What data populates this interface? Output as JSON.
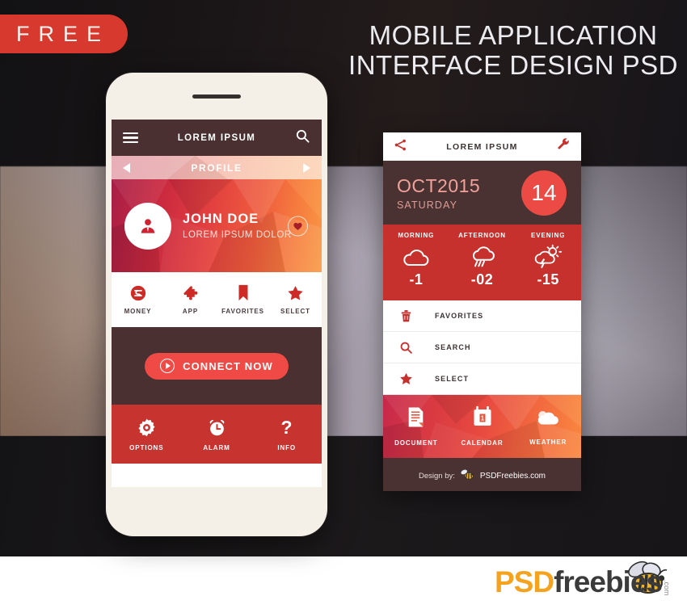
{
  "poster": {
    "badge": "FREE",
    "headline_line1": "MOBILE APPLICATION",
    "headline_line2": "INTERFACE DESIGN PSD"
  },
  "phone": {
    "app_bar": {
      "menu_icon": "hamburger-icon",
      "title": "LOREM IPSUM",
      "search_icon": "search-icon"
    },
    "profile_nav": {
      "prev_icon": "arrow-left-icon",
      "label": "PROFILE",
      "next_icon": "arrow-right-icon"
    },
    "hero": {
      "avatar_icon": "user-icon",
      "name": "JOHN DOE",
      "subtitle": "LOREM IPSUM DOLOR",
      "favorite_icon": "heart-icon"
    },
    "quick_actions": [
      {
        "label": "MONEY",
        "icon": "dollar-circle-icon"
      },
      {
        "label": "APP",
        "icon": "puzzle-icon"
      },
      {
        "label": "FAVORITES",
        "icon": "bookmark-icon"
      },
      {
        "label": "SELECT",
        "icon": "star-icon"
      }
    ],
    "connect": {
      "label": "CONNECT NOW",
      "icon": "play-circle-icon"
    },
    "bottom_actions": [
      {
        "label": "OPTIONS",
        "icon": "gear-icon"
      },
      {
        "label": "ALARM",
        "icon": "alarm-clock-icon"
      },
      {
        "label": "INFO",
        "icon": "question-mark-icon"
      }
    ]
  },
  "widget": {
    "head": {
      "share_icon": "share-icon",
      "title": "LOREM IPSUM",
      "settings_icon": "wrench-icon"
    },
    "date": {
      "month_year": "OCT2015",
      "weekday": "SATURDAY",
      "day": "14"
    },
    "weather": [
      {
        "label": "MORNING",
        "icon": "cloud-icon",
        "temp": "-1"
      },
      {
        "label": "AFTERNOON",
        "icon": "rain-cloud-icon",
        "temp": "-02"
      },
      {
        "label": "EVENING",
        "icon": "storm-sun-icon",
        "temp": "-15"
      }
    ],
    "list": [
      {
        "label": "FAVORITES",
        "icon": "trash-icon"
      },
      {
        "label": "SEARCH",
        "icon": "search-icon"
      },
      {
        "label": "SELECT",
        "icon": "star-icon"
      }
    ],
    "tabs": [
      {
        "label": "DOCUMENT",
        "icon": "document-icon"
      },
      {
        "label": "CALENDAR",
        "icon": "calendar-icon"
      },
      {
        "label": "WEATHER",
        "icon": "cloud-icon"
      }
    ],
    "footer": {
      "credit_prefix": "Design by:",
      "bee_icon": "bee-icon",
      "credit_site": "PSDFreebies.com"
    }
  },
  "brand": {
    "logo_part1": "PSD",
    "logo_part2": "freebies",
    "logo_tld": ".com",
    "bee_icon": "bee-icon"
  },
  "colors": {
    "accent_red": "#c7312d",
    "bright_red": "#ec4a44",
    "dark_maroon": "#4a3232",
    "orange": "#f9883f",
    "logo_orange": "#f5a21f"
  }
}
